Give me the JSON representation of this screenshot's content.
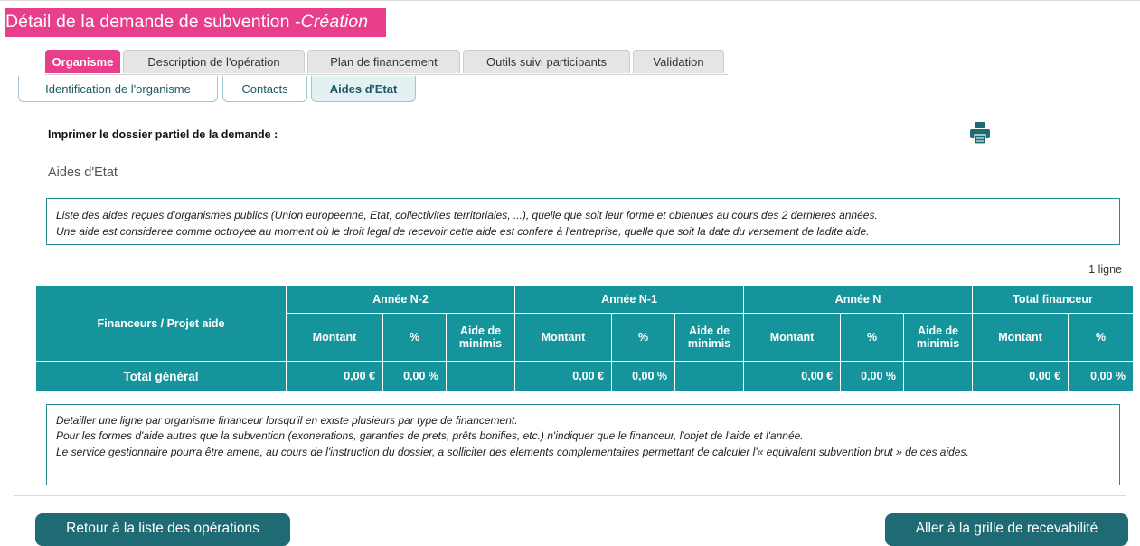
{
  "page": {
    "title": "Détail de la demande de subvention - ",
    "mode": "Création"
  },
  "tabs": [
    {
      "label": "Organisme",
      "active": true
    },
    {
      "label": "Description de l'opération",
      "active": false
    },
    {
      "label": "Plan de financement",
      "active": false
    },
    {
      "label": "Outils suivi participants",
      "active": false
    },
    {
      "label": "Validation",
      "active": false
    }
  ],
  "subtabs": [
    {
      "label": "Identification de l'organisme",
      "active": false
    },
    {
      "label": "Contacts",
      "active": false
    },
    {
      "label": "Aides d'Etat",
      "active": true
    }
  ],
  "print": {
    "label": "Imprimer le dossier partiel de la demande :",
    "icon": "printer-icon"
  },
  "section_title": "Aides d'Etat",
  "info_top": [
    "Liste des aides reçues d'organismes publics (Union europeenne, Etat, collectivites territoriales, ...), quelle que soit leur forme et obtenues au cours des 2 dernieres années.",
    "Une aide est consideree comme octroyee au moment où le droit legal de recevoir cette aide est confere à l'entreprise, quelle que soit la date du versement de ladite aide."
  ],
  "row_count": "1 ligne",
  "table": {
    "col_financeurs": "Financeurs / Projet aide",
    "groups": [
      "Année N-2",
      "Année N-1",
      "Année N",
      "Total financeur"
    ],
    "sub_montant": "Montant",
    "sub_pct": "%",
    "sub_minimis": "Aide de minimis",
    "total_label": "Total général",
    "totals": {
      "n2_montant": "0,00 €",
      "n2_pct": "0,00 %",
      "n2_minimis": "",
      "n1_montant": "0,00 €",
      "n1_pct": "0,00 %",
      "n1_minimis": "",
      "n_montant": "0,00 €",
      "n_pct": "0,00 %",
      "n_minimis": "",
      "tot_montant": "0,00 €",
      "tot_pct": "0,00 %"
    }
  },
  "info_bottom": [
    "Detailler une ligne par organisme financeur lorsqu'il en existe plusieurs par type de financement.",
    "Pour les formes d'aide autres que la subvention (exonerations, garanties de prets, prêts bonifies, etc.) n'indiquer que le financeur, l'objet de l'aide et l'année.",
    "Le service gestionnaire pourra être amene, au cours de l'instruction du dossier, a solliciter des elements complementaires permettant de calculer l'« equivalent subvention brut » de ces aides."
  ],
  "buttons": {
    "back": "Retour à la liste des opérations",
    "next": "Aller à la grille de recevabilité"
  },
  "colors": {
    "accent_pink": "#e83e8c",
    "table_teal": "#16949c",
    "button_dark_teal": "#1f6b73"
  }
}
